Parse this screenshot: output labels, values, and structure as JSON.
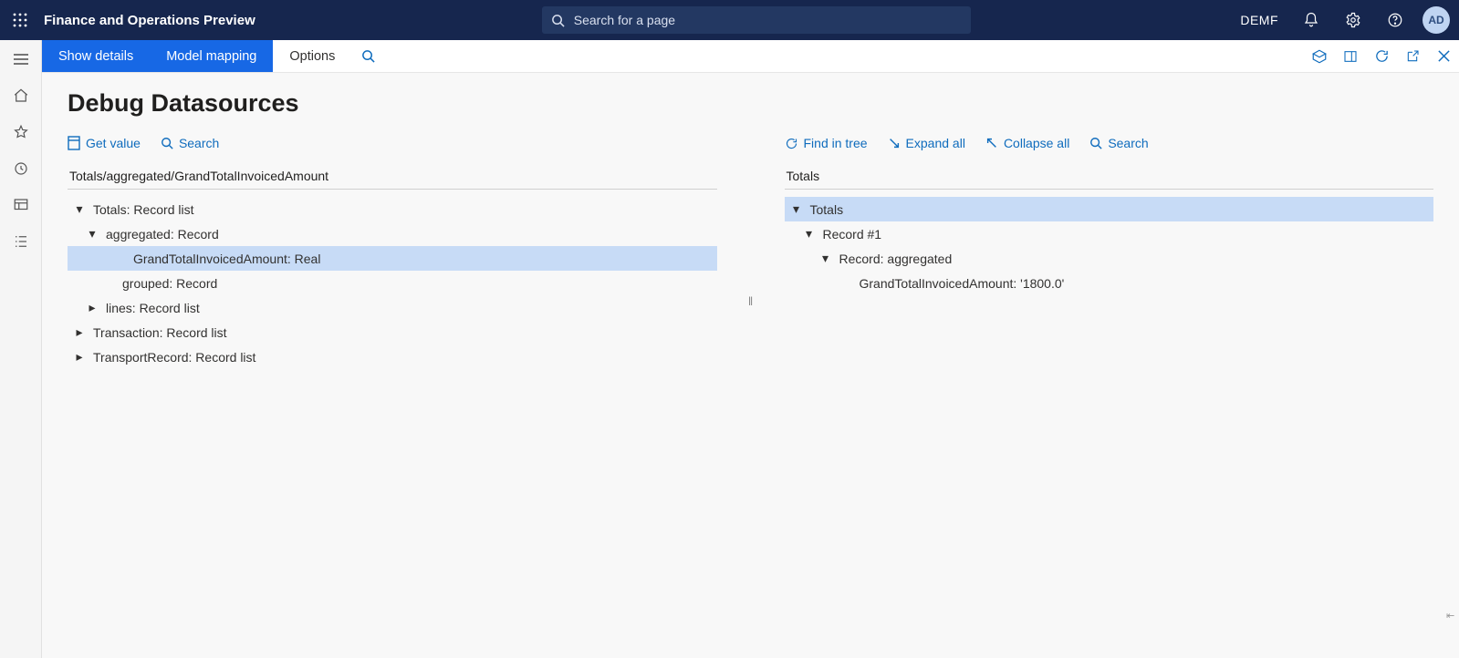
{
  "top": {
    "brand": "Finance and Operations Preview",
    "searchPlaceholder": "Search for a page",
    "company": "DEMF",
    "avatar": "AD"
  },
  "actions": {
    "showDetails": "Show details",
    "modelMapping": "Model mapping",
    "options": "Options"
  },
  "page": {
    "title": "Debug Datasources"
  },
  "left": {
    "toolbar": {
      "getValue": "Get value",
      "search": "Search"
    },
    "path": "Totals/aggregated/GrandTotalInvoicedAmount",
    "tree": {
      "n0": "Totals: Record list",
      "n1": "aggregated: Record",
      "n2": "GrandTotalInvoicedAmount: Real",
      "n3": "grouped: Record",
      "n4": "lines: Record list",
      "n5": "Transaction: Record list",
      "n6": "TransportRecord: Record list"
    }
  },
  "right": {
    "toolbar": {
      "find": "Find in tree",
      "expand": "Expand all",
      "collapse": "Collapse all",
      "search": "Search"
    },
    "path": "Totals",
    "tree": {
      "n0": "Totals",
      "n1": "Record #1",
      "n2": "Record: aggregated",
      "n3": "GrandTotalInvoicedAmount: '1800.0'"
    }
  }
}
